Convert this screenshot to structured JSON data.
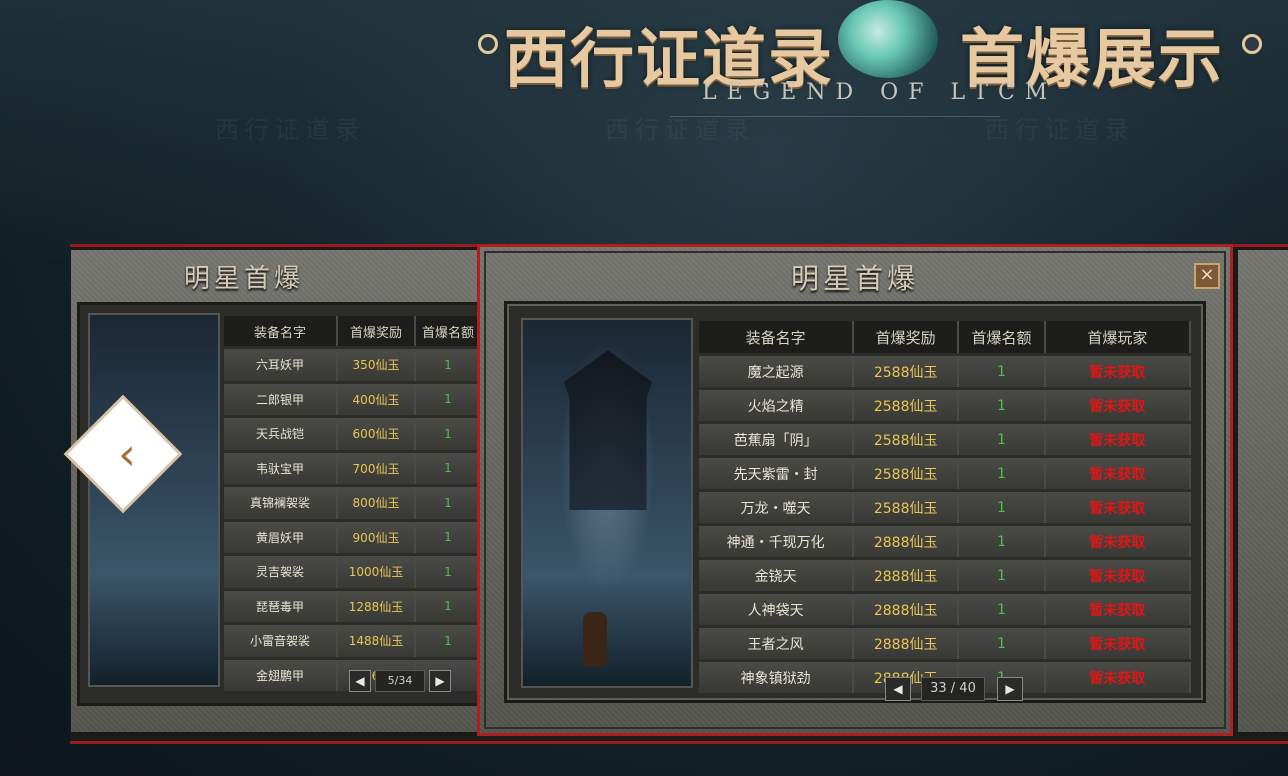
{
  "header": {
    "title_left": "西行证道录",
    "title_right": "首爆展示",
    "subtitle": "LEGEND OF LTCM",
    "watermark": "西行证道录"
  },
  "main_panel": {
    "title": "明星首爆",
    "close_label": "×",
    "columns": [
      "装备名字",
      "首爆奖励",
      "首爆名额",
      "首爆玩家"
    ],
    "rows": [
      {
        "name": "魔之起源",
        "reward": "2588仙玉",
        "quota": "1",
        "player": "暂未获取"
      },
      {
        "name": "火焰之精",
        "reward": "2588仙玉",
        "quota": "1",
        "player": "暂未获取"
      },
      {
        "name": "芭蕉扇「阴」",
        "reward": "2588仙玉",
        "quota": "1",
        "player": "暂未获取"
      },
      {
        "name": "先天紫雷・封",
        "reward": "2588仙玉",
        "quota": "1",
        "player": "暂未获取"
      },
      {
        "name": "万龙・噬天",
        "reward": "2588仙玉",
        "quota": "1",
        "player": "暂未获取"
      },
      {
        "name": "神通・千现万化",
        "reward": "2888仙玉",
        "quota": "1",
        "player": "暂未获取"
      },
      {
        "name": "金铙天",
        "reward": "2888仙玉",
        "quota": "1",
        "player": "暂未获取"
      },
      {
        "name": "人神袋天",
        "reward": "2888仙玉",
        "quota": "1",
        "player": "暂未获取"
      },
      {
        "name": "王者之风",
        "reward": "2888仙玉",
        "quota": "1",
        "player": "暂未获取"
      },
      {
        "name": "神象镇狱劲",
        "reward": "2888仙玉",
        "quota": "1",
        "player": "暂未获取"
      }
    ],
    "pager": {
      "prev": "◀",
      "page": "33 / 40",
      "next": "▶"
    }
  },
  "left_panel": {
    "title": "明星首爆",
    "columns": [
      "装备名字",
      "首爆奖励",
      "首爆名额"
    ],
    "rows": [
      {
        "name": "六耳妖甲",
        "reward": "350仙玉",
        "quota": "1"
      },
      {
        "name": "二郎银甲",
        "reward": "400仙玉",
        "quota": "1"
      },
      {
        "name": "天兵战铠",
        "reward": "600仙玉",
        "quota": "1"
      },
      {
        "name": "韦驮宝甲",
        "reward": "700仙玉",
        "quota": "1"
      },
      {
        "name": "真锦襕袈裟",
        "reward": "800仙玉",
        "quota": "1"
      },
      {
        "name": "黄眉妖甲",
        "reward": "900仙玉",
        "quota": "1"
      },
      {
        "name": "灵吉袈裟",
        "reward": "1000仙玉",
        "quota": "1"
      },
      {
        "name": "琵琶毒甲",
        "reward": "1288仙玉",
        "quota": "1"
      },
      {
        "name": "小雷音袈裟",
        "reward": "1488仙玉",
        "quota": "1"
      },
      {
        "name": "金翅鹏甲",
        "reward": "1666仙玉",
        "quota": "1"
      }
    ],
    "pager": {
      "prev": "◀",
      "page": "5/34",
      "next": "▶"
    }
  },
  "nav": {
    "prev_arrow": "‹"
  },
  "colors": {
    "frame_red": "#b21e1e",
    "reward_gold": "#e9c655",
    "quota_green": "#4cc14c",
    "player_red": "#e01616"
  }
}
